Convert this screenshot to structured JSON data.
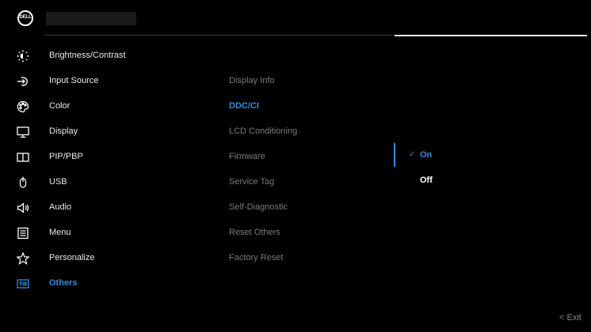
{
  "header": {
    "logo_text": "DELL"
  },
  "menu": {
    "items": [
      {
        "label": "Brightness/Contrast",
        "icon": "brightness-icon"
      },
      {
        "label": "Input Source",
        "icon": "input-source-icon"
      },
      {
        "label": "Color",
        "icon": "color-palette-icon"
      },
      {
        "label": "Display",
        "icon": "display-icon"
      },
      {
        "label": "PIP/PBP",
        "icon": "pip-pbp-icon"
      },
      {
        "label": "USB",
        "icon": "usb-icon"
      },
      {
        "label": "Audio",
        "icon": "audio-icon"
      },
      {
        "label": "Menu",
        "icon": "menu-icon"
      },
      {
        "label": "Personalize",
        "icon": "star-icon"
      },
      {
        "label": "Others",
        "icon": "others-icon"
      }
    ],
    "active_index": 9
  },
  "submenu": {
    "items": [
      "Display Info",
      "DDC/CI",
      "LCD Conditioning",
      "Firmware",
      "Service Tag",
      "Self-Diagnostic",
      "Reset Others",
      "Factory Reset"
    ],
    "active_index": 1
  },
  "options": {
    "items": [
      "On",
      "Off"
    ],
    "selected": "On",
    "check_glyph": "✓"
  },
  "footer": {
    "exit_label": "< Exit"
  },
  "colors": {
    "accent": "#2f8be2",
    "background": "#000000",
    "text": "#e9e9e9",
    "muted": "#7a7a7a"
  }
}
